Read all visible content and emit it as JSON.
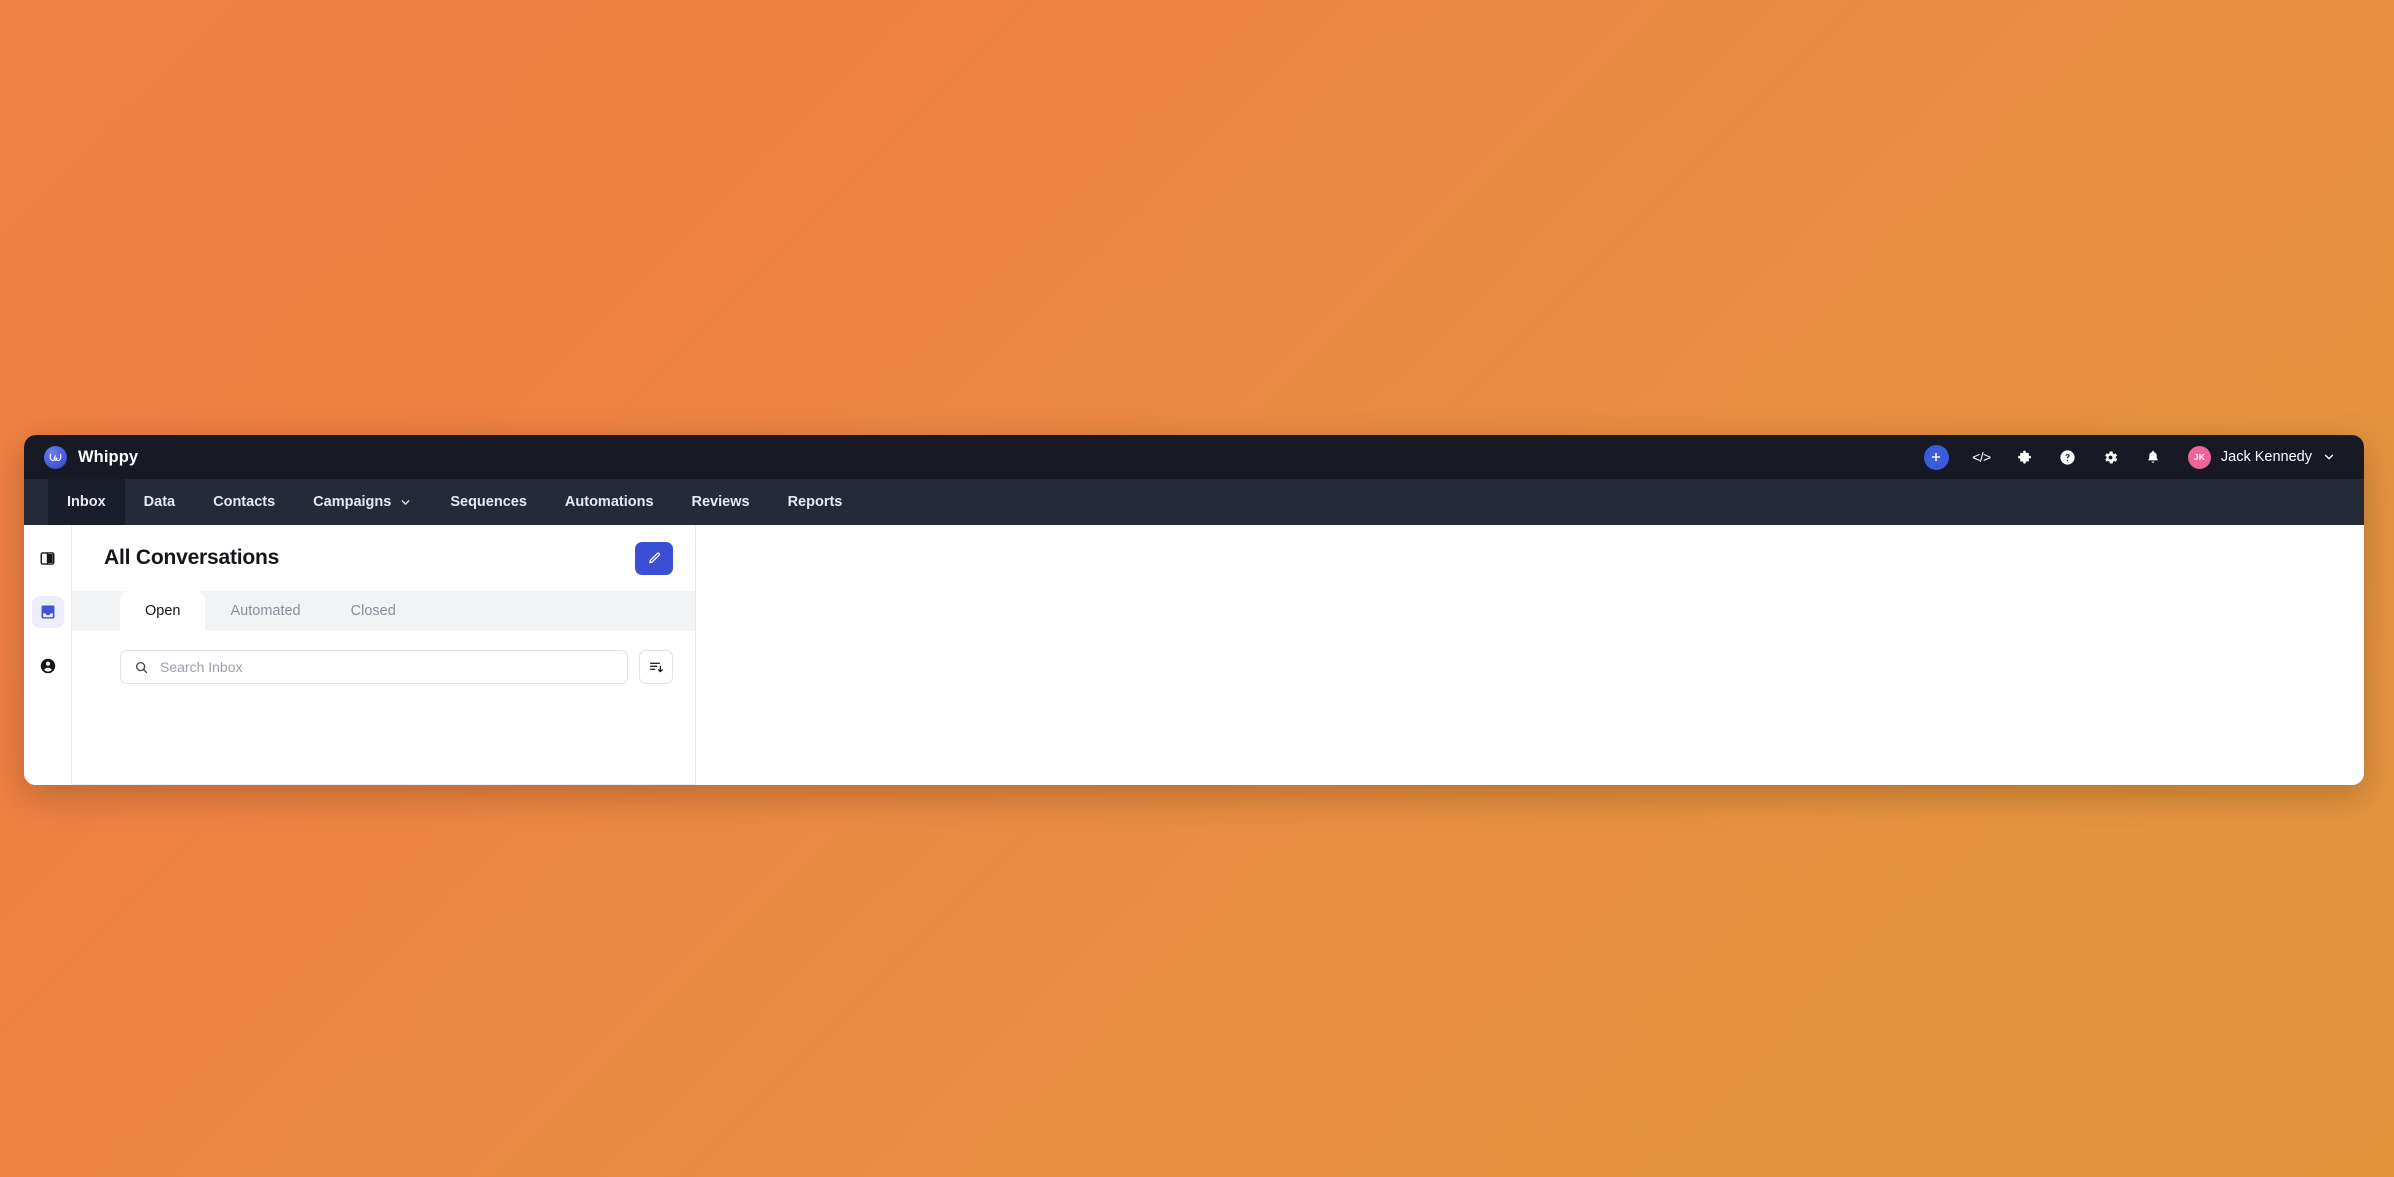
{
  "desktop": {
    "background_color": "#ef8145",
    "background_color_end": "#e3953e"
  },
  "topbar": {
    "brand_name": "Whippy",
    "logo_icon": "whippy-butterfly-logo",
    "background_color": "#171a24",
    "actions": [
      {
        "name": "add-button",
        "icon": "plus-icon",
        "label": "+",
        "color": "#3b5bdb"
      },
      {
        "name": "developer-button",
        "icon": "code-brackets-icon",
        "label": "</>"
      },
      {
        "name": "integrations-button",
        "icon": "puzzle-piece-icon",
        "label": ""
      },
      {
        "name": "help-button",
        "icon": "question-circle-icon",
        "label": ""
      },
      {
        "name": "settings-button",
        "icon": "gear-icon",
        "label": ""
      },
      {
        "name": "notifications-button",
        "icon": "bell-icon",
        "label": ""
      }
    ],
    "user": {
      "initials": "JK",
      "name": "Jack Kennedy",
      "avatar_color": "#f06595",
      "chevron_icon": "chevron-down-icon"
    }
  },
  "navbar": {
    "background_color": "#252a38",
    "active_background_color": "#1a1e2a",
    "items": [
      {
        "label": "Inbox",
        "active": true,
        "has_chevron": false
      },
      {
        "label": "Data",
        "active": false,
        "has_chevron": false
      },
      {
        "label": "Contacts",
        "active": false,
        "has_chevron": false
      },
      {
        "label": "Campaigns",
        "active": false,
        "has_chevron": true
      },
      {
        "label": "Sequences",
        "active": false,
        "has_chevron": false
      },
      {
        "label": "Automations",
        "active": false,
        "has_chevron": false
      },
      {
        "label": "Reviews",
        "active": false,
        "has_chevron": false
      },
      {
        "label": "Reports",
        "active": false,
        "has_chevron": false
      }
    ]
  },
  "rail": {
    "items": [
      {
        "name": "sidebar-toggle",
        "icon": "panel-layout-icon",
        "active": false
      },
      {
        "name": "inbox",
        "icon": "inbox-tray-icon",
        "active": true
      },
      {
        "name": "account",
        "icon": "account-circle-icon",
        "active": false
      }
    ],
    "active_background_color": "#eceefc",
    "active_icon_color": "#4353d8"
  },
  "conversations": {
    "title": "All Conversations",
    "compose": {
      "icon": "pencil-edit-icon",
      "color": "#3b4fd4"
    },
    "tabs": [
      {
        "label": "Open",
        "active": true
      },
      {
        "label": "Automated",
        "active": false
      },
      {
        "label": "Closed",
        "active": false
      }
    ],
    "search": {
      "placeholder": "Search Inbox",
      "value": "",
      "icon": "search-icon"
    },
    "sort": {
      "name": "sort-button",
      "icon": "sort-descending-icon"
    }
  }
}
